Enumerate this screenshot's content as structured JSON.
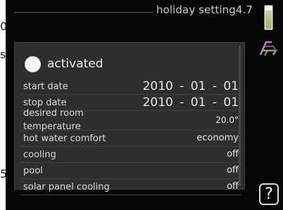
{
  "margin_fragments": [
    "0",
    "s",
    "5"
  ],
  "header": {
    "title": "holiday setting4.7"
  },
  "activated": {
    "label": "activated",
    "checked": false
  },
  "settings": {
    "start_date": {
      "label": "start date",
      "value": "2010 - 01 - 01"
    },
    "stop_date": {
      "label": "stop date",
      "value": "2010 - 01 - 01"
    },
    "desired_room_temperature": {
      "label_line1": "desired room",
      "label_line2": "temperature",
      "value": "20.0°"
    },
    "hot_water_comfort": {
      "label": "hot water comfort",
      "value": "economy"
    },
    "cooling": {
      "label": "cooling",
      "value": "off"
    },
    "pool": {
      "label": "pool",
      "value": "off"
    },
    "solar_panel_cooling": {
      "label": "solar panel cooling",
      "value": "off"
    }
  },
  "help": {
    "label": "?"
  },
  "icons": {
    "battery": "battery-icon",
    "holiday": "deck-chair-icon",
    "help": "help-icon"
  },
  "colors": {
    "background": "#070707",
    "panel": "#2e2e2e",
    "text": "#dcdcdc",
    "chair_accent": "#7a3f8c"
  }
}
